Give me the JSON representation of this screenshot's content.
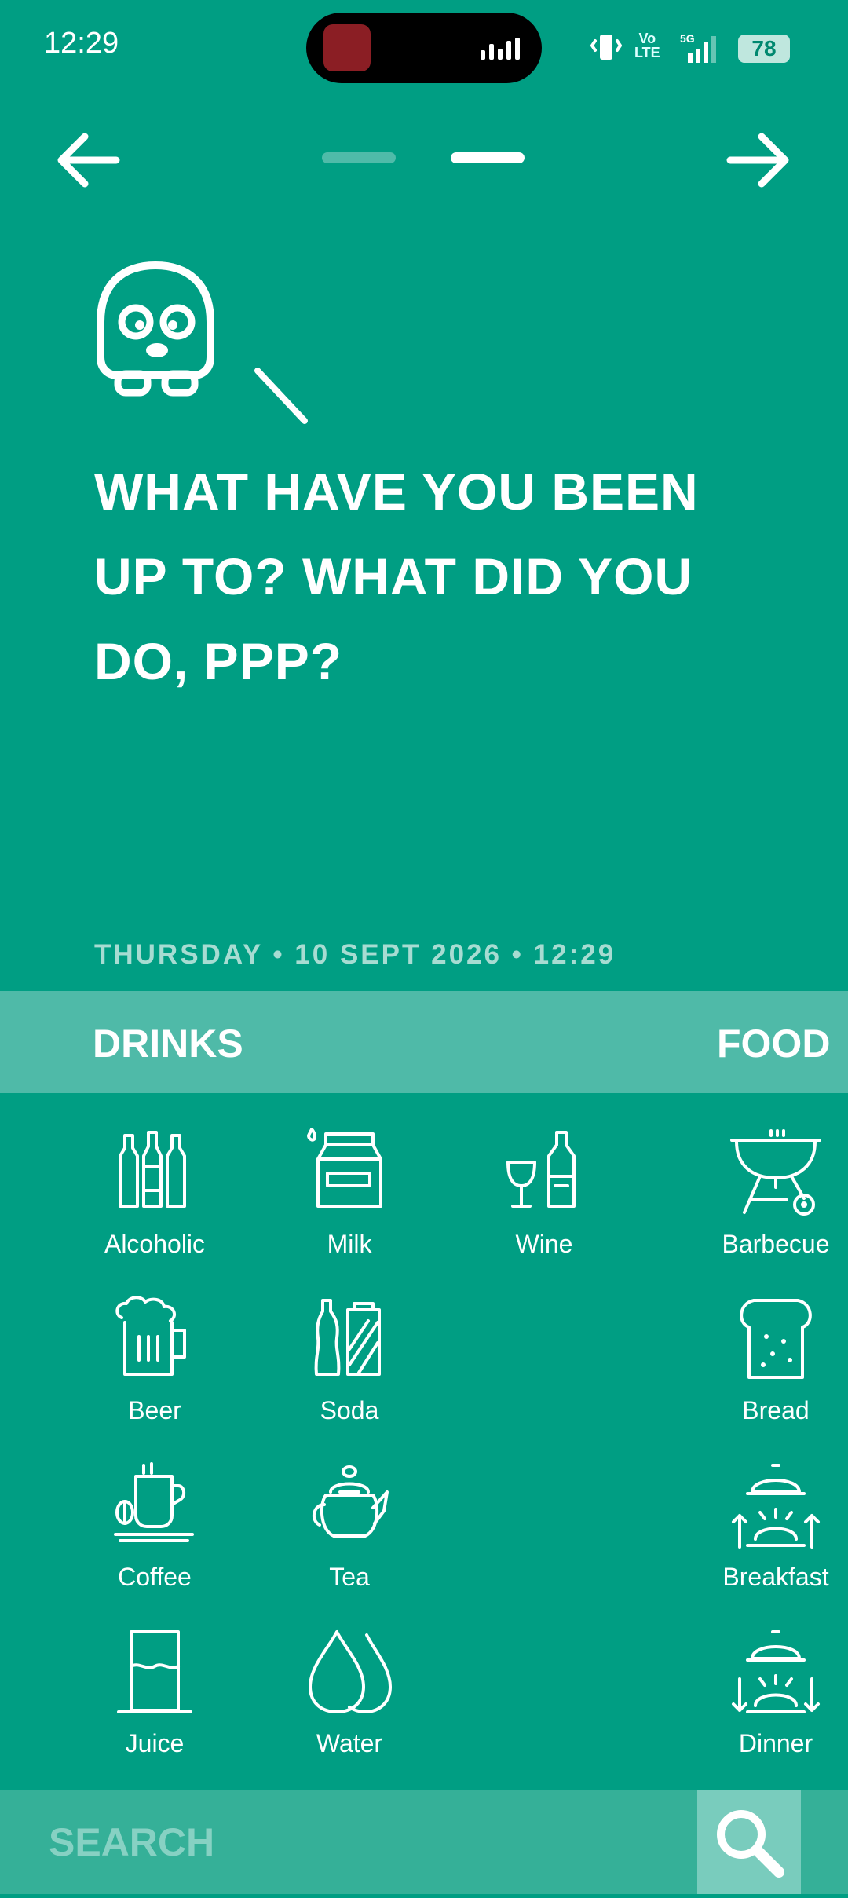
{
  "status_bar": {
    "time": "12:29",
    "network_label": "Vo\nLTE",
    "network_gen": "5G",
    "battery": "78"
  },
  "nav": {
    "back_icon": "arrow-left-icon",
    "forward_icon": "arrow-right-icon",
    "page_count": 2,
    "active_page": 2
  },
  "prompt": {
    "headline": "WHAT HAVE YOU BEEN UP TO? WHAT DID YOU DO, PPP?",
    "datetime": "THURSDAY • 10 SEPT 2026 • 12:29"
  },
  "categories": {
    "drinks": "DRINKS",
    "food": "FOOD"
  },
  "drinks": [
    {
      "label": "Alcoholic",
      "icon": "bottles-icon"
    },
    {
      "label": "Milk",
      "icon": "milk-carton-icon"
    },
    {
      "label": "Wine",
      "icon": "wine-icon"
    },
    {
      "label": "Beer",
      "icon": "beer-mug-icon"
    },
    {
      "label": "Soda",
      "icon": "soda-icon"
    },
    {
      "label": "Coffee",
      "icon": "coffee-cup-icon"
    },
    {
      "label": "Tea",
      "icon": "teapot-icon"
    },
    {
      "label": "Juice",
      "icon": "juice-glass-icon"
    },
    {
      "label": "Water",
      "icon": "water-drops-icon"
    }
  ],
  "food": [
    {
      "label": "Barbecue",
      "icon": "barbecue-grill-icon"
    },
    {
      "label": "Bread",
      "icon": "bread-icon"
    },
    {
      "label": "Breakfast",
      "icon": "cloche-sunrise-icon"
    },
    {
      "label": "Dinner",
      "icon": "cloche-sunset-icon"
    }
  ],
  "search": {
    "placeholder": "SEARCH",
    "icon": "search-icon"
  },
  "colors": {
    "background": "#009e83",
    "category_bar": "#4fbaa8",
    "search_bar": "#35b098",
    "search_button": "#79ccbd",
    "datetime_text": "#a7dcd2"
  }
}
